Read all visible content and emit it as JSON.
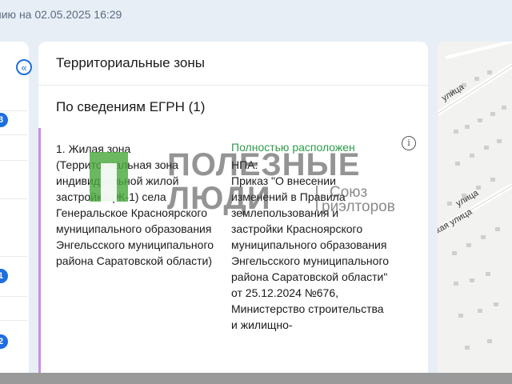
{
  "header": {
    "date_text": "нию на 02.05.2025 16:29"
  },
  "left_panel": {
    "collapse_glyph": "«",
    "badges": [
      "3",
      "1",
      "2"
    ]
  },
  "card": {
    "title": "Территориальные зоны",
    "egrn_title": "По сведениям ЕГРН (1)",
    "entry": {
      "zone": "1. Жилая зона (Территориальная зона индивидуальной жилой застройки (Ж-1) села Генеральское Красноярского муниципального образования Энгельсского муниципального района Саратовской области)",
      "status": "Полностью расположен",
      "npa_label": "НПА:",
      "npa_text": "Приказ \"О внесении изменений в Правила землепользования и застройки Красноярского муниципального образования Энгельсского муниципального района Саратовской области\" от 25.12.2024 №676, Министерство строительства и жилищно-"
    }
  },
  "map": {
    "streets": [
      "улица",
      "улица",
      "ская улица"
    ]
  },
  "watermark": {
    "line1": "ПОЛЕЗНЫЕ",
    "line2": "ЛЮДИ",
    "union1": "Союз",
    "union2": "риэлторов"
  },
  "colors": {
    "accent": "#1d6fe0",
    "status_green": "#2e9b4a",
    "entry_bar": "#c98fe6"
  }
}
